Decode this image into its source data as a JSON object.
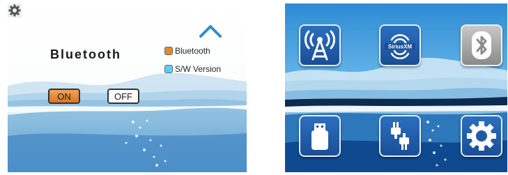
{
  "bluetooth_screen": {
    "title": "Bluetooth",
    "legend": [
      {
        "label": "Bluetooth",
        "color": "#e38a2c"
      },
      {
        "label": "S/W Version",
        "color": "#5ad0f0"
      }
    ],
    "on_label": "ON",
    "off_label": "OFF",
    "icons": {
      "settings": "gear-icon",
      "navigate_up": "chevron-up-icon"
    }
  },
  "menu_screen": {
    "tiles": [
      {
        "name": "radio-tile",
        "icon": "radio-tower-icon"
      },
      {
        "name": "siriusxm-tile",
        "icon": "siriusxm-icon",
        "text": "SiriusXM"
      },
      {
        "name": "bluetooth-tile",
        "icon": "bluetooth-icon"
      },
      {
        "name": "usb-tile",
        "icon": "usb-icon"
      },
      {
        "name": "aux-tile",
        "icon": "aux-plug-icon"
      },
      {
        "name": "settings-tile",
        "icon": "gear-icon"
      }
    ]
  },
  "colors": {
    "accent_orange": "#e38a2c",
    "accent_cyan": "#5ad0f0",
    "tile_blue": "#1d5fb0",
    "chevron_blue": "#2f8bd6"
  }
}
